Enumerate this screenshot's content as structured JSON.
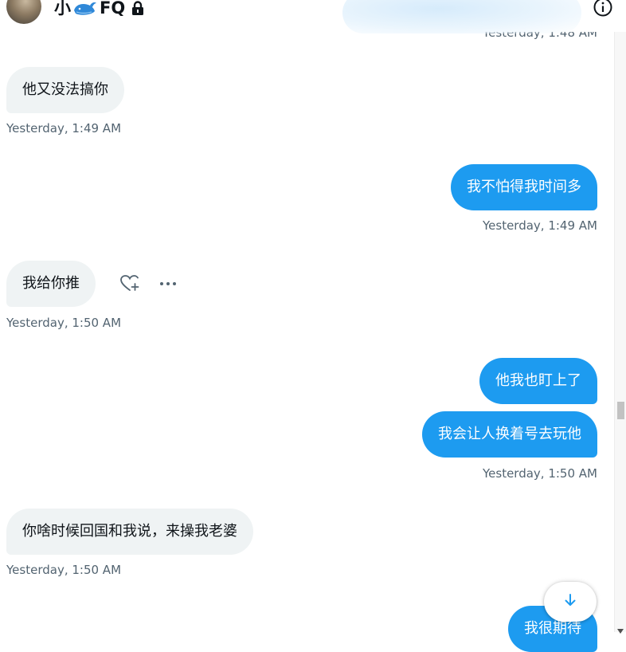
{
  "header": {
    "name_prefix": "小",
    "name_suffix": "FQ",
    "avatar_icon": "avatar",
    "emoji_icon": "whale-icon",
    "lock_icon": "lock-icon",
    "info_icon": "info-icon"
  },
  "messages": [
    {
      "direction": "outgoing",
      "text": "",
      "timestamp": "Yesterday, 1:48 AM"
    },
    {
      "direction": "incoming",
      "text": "他又没法搞你",
      "timestamp": "Yesterday, 1:49 AM"
    },
    {
      "direction": "outgoing",
      "text": "我不怕得我时间多",
      "timestamp": "Yesterday, 1:49 AM"
    },
    {
      "direction": "incoming",
      "text": "我给你推",
      "timestamp": "Yesterday, 1:50 AM"
    },
    {
      "direction": "outgoing",
      "text": "他我也盯上了",
      "timestamp": ""
    },
    {
      "direction": "outgoing",
      "text": "我会让人换着号去玩他",
      "timestamp": "Yesterday, 1:50 AM"
    },
    {
      "direction": "incoming",
      "text": "你啥时候回国和我说，来操我老婆",
      "timestamp": "Yesterday, 1:50 AM"
    },
    {
      "direction": "outgoing",
      "text": "我很期待",
      "timestamp": ""
    }
  ],
  "hover_actions": {
    "react_icon": "heart-plus-icon",
    "more_icon": "more-horizontal-icon"
  },
  "scroll_down_icon": "arrow-down-icon",
  "colors": {
    "outgoing_bubble": "#1d9bf0",
    "incoming_bubble": "#eff3f4",
    "timestamp": "#536471",
    "text": "#0f1419"
  }
}
